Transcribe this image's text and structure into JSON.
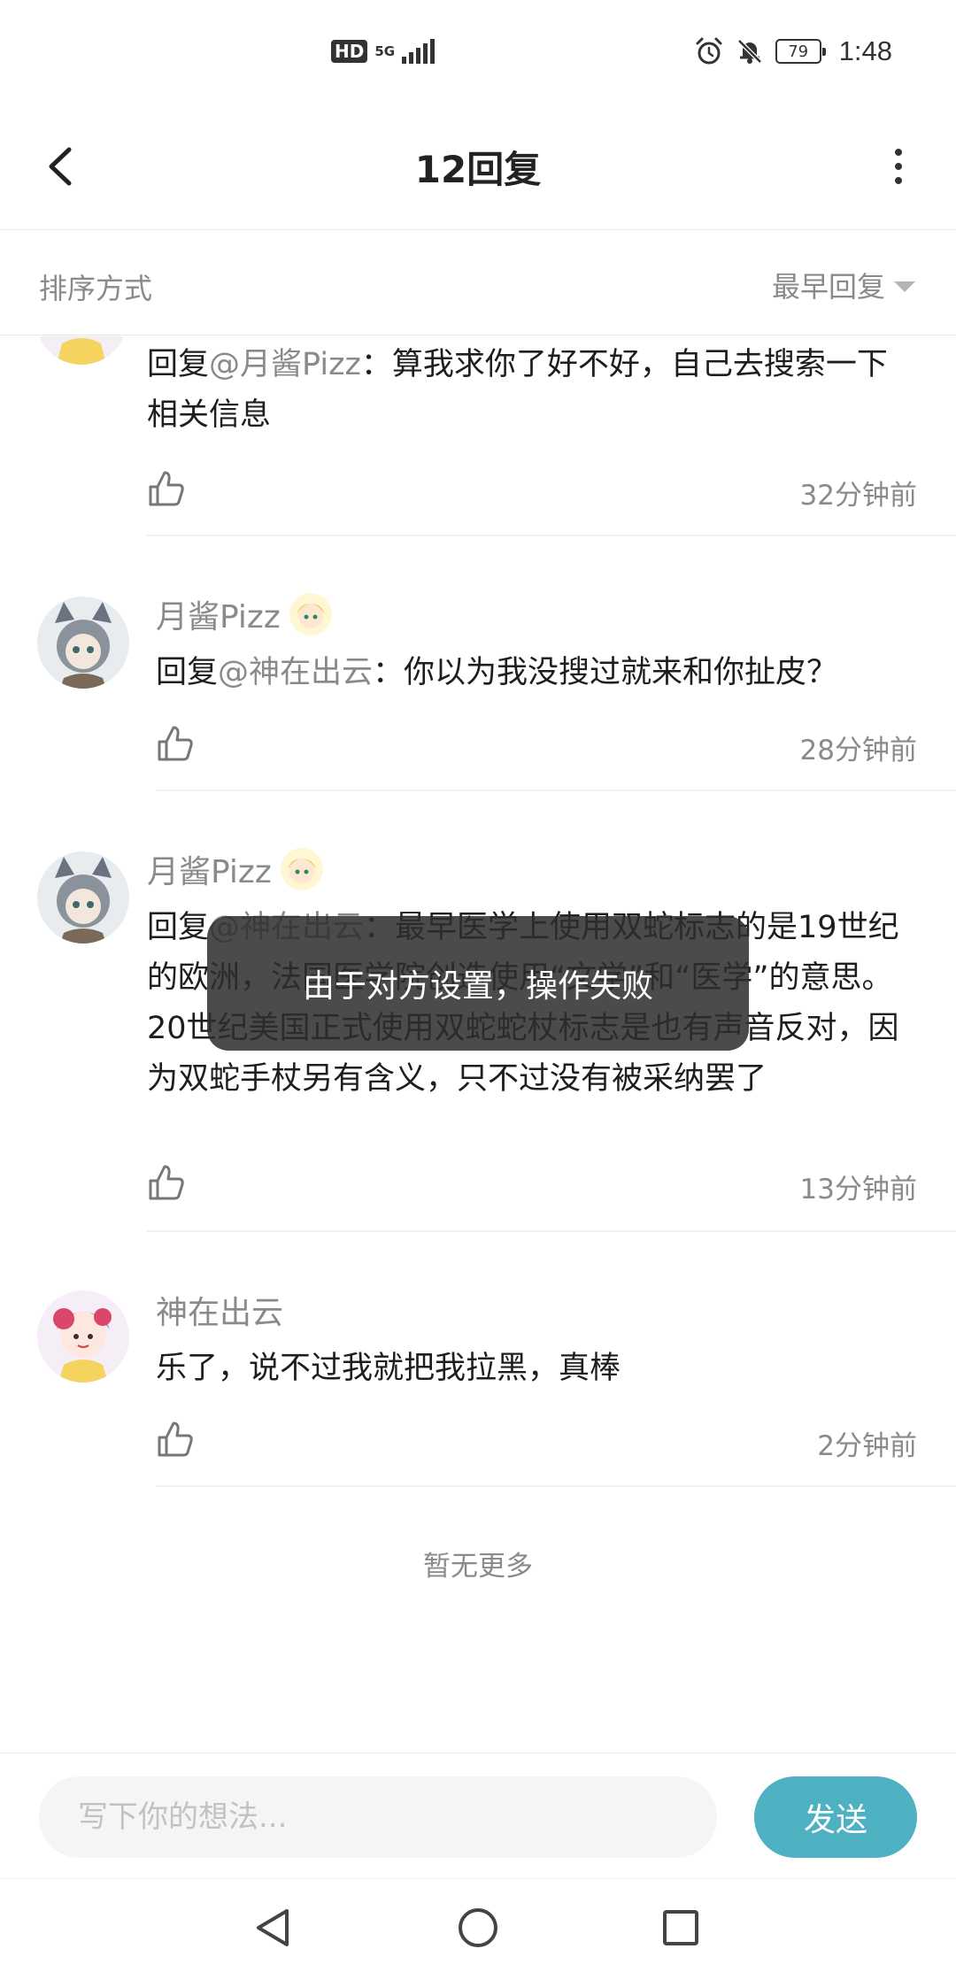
{
  "status_bar": {
    "hd": "HD",
    "network": "5G",
    "battery": "79",
    "time": "1:48"
  },
  "header": {
    "title": "12回复"
  },
  "sort": {
    "label": "排序方式",
    "value": "最早回复"
  },
  "replies": [
    {
      "prefix": "回复",
      "mention": "@月酱Pizz",
      "text": "：算我求你了好不好，自己去搜索一下相关信息",
      "time": "32分钟前"
    },
    {
      "user": "月酱Pizz",
      "prefix": "回复",
      "mention": "@神在出云",
      "text": "：你以为我没搜过就来和你扯皮？",
      "time": "28分钟前"
    },
    {
      "user": "月酱Pizz",
      "prefix": "回复",
      "mention": "@神在出云",
      "text": "：最早医学上使用双蛇标志的是19世纪的欧洲，法国医学院创造使用“文学”和“医学”的意思。20世纪美国正式使用双蛇蛇杖标志是也有声音反对，因为双蛇手杖另有含义，只不过没有被采纳罢了",
      "time": "13分钟前"
    },
    {
      "user": "神在出云",
      "text": "乐了，说不过我就把我拉黑，真棒",
      "time": "2分钟前"
    }
  ],
  "end_text": "暂无更多",
  "toast": "由于对方设置，操作失败",
  "input": {
    "placeholder": "写下你的想法..."
  },
  "send_label": "发送",
  "colors": {
    "accent": "#4eb1c1",
    "muted_text": "#8a8a8a",
    "toast_bg": "#2d2d2d"
  }
}
